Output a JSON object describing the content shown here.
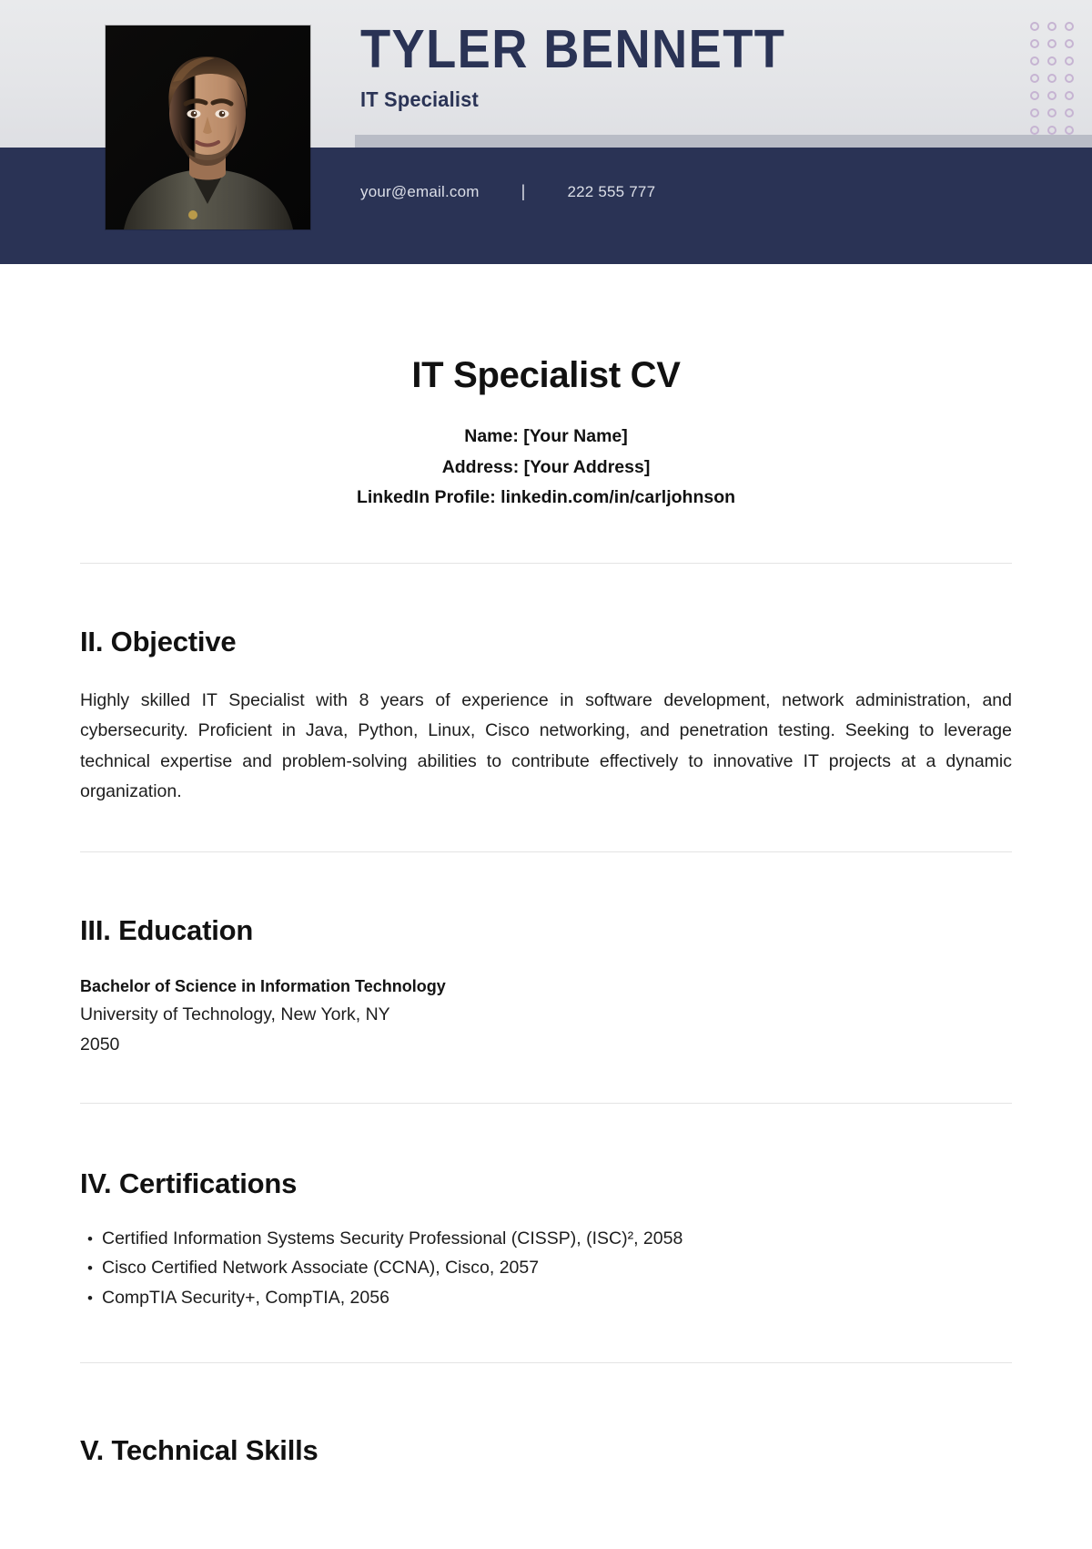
{
  "header": {
    "name": "TYLER BENNETT",
    "role": "IT Specialist",
    "email": "your@email.com",
    "separator": "|",
    "phone": "222 555 777",
    "accent_navy": "#2a3355",
    "accent_gray": "#b9bcc6",
    "dot_color": "#c6b4d2",
    "dot_rows": 7,
    "dot_cols": 3
  },
  "document": {
    "title": "IT Specialist CV",
    "meta": [
      "Name: [Your Name]",
      "Address: [Your Address]",
      "LinkedIn Profile: linkedin.com/in/carljohnson"
    ]
  },
  "sections": {
    "objective": {
      "heading": "II. Objective",
      "body": "Highly skilled IT Specialist with 8 years of experience in software development, network administration, and cybersecurity. Proficient in Java, Python, Linux, Cisco networking, and penetration testing. Seeking to leverage technical expertise and problem-solving abilities to contribute effectively to innovative IT projects at a dynamic organization."
    },
    "education": {
      "heading": "III. Education",
      "degree": "Bachelor of Science in Information Technology",
      "school": "University of Technology, New York, NY",
      "year": "2050"
    },
    "certifications": {
      "heading": "IV. Certifications",
      "bullet_glyph": "•",
      "items": [
        "Certified Information Systems Security Professional (CISSP), (ISC)², 2058",
        "Cisco Certified Network Associate (CCNA), Cisco, 2057",
        "CompTIA Security+, CompTIA, 2056"
      ]
    },
    "skills": {
      "heading": "V. Technical Skills"
    }
  }
}
